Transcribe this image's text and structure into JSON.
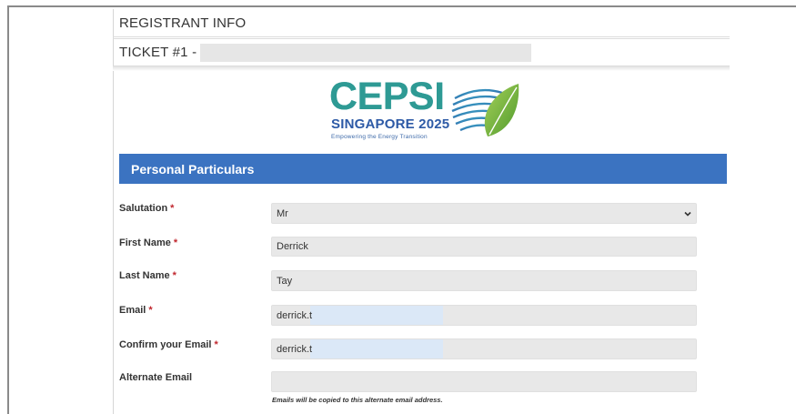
{
  "header": {
    "section_title": "REGISTRANT INFO",
    "ticket_label": "TICKET #1 -"
  },
  "logo": {
    "main": "CEPSI",
    "sub": "SINGAPORE 2025",
    "tagline": "Empowering the Energy Transition",
    "colors": {
      "teal": "#2e9a94",
      "blue": "#2d5aa6",
      "green": "#7bbf3a"
    }
  },
  "section": {
    "title": "Personal Particulars",
    "color": "#3b73c1"
  },
  "form": {
    "salutation": {
      "label": "Salutation",
      "required": "*",
      "value": "Mr"
    },
    "first_name": {
      "label": "First Name",
      "required": "*",
      "value": "Derrick"
    },
    "last_name": {
      "label": "Last Name",
      "required": "*",
      "value": "Tay"
    },
    "email": {
      "label": "Email",
      "required": "*",
      "value": "derrick.t"
    },
    "confirm_email": {
      "label": "Confirm your Email",
      "required": "*",
      "value": "derrick.t"
    },
    "alternate_email": {
      "label": "Alternate Email",
      "value": "",
      "hint": "Emails will be copied to this alternate email address."
    }
  },
  "icons": {
    "select": "chevron-down-icon"
  }
}
